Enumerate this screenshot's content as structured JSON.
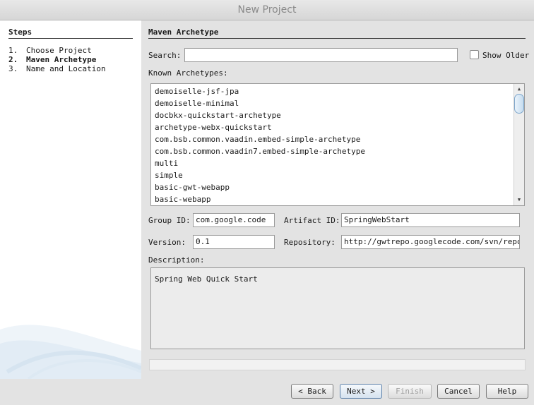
{
  "window": {
    "title": "New Project"
  },
  "steps": {
    "heading": "Steps",
    "items": [
      {
        "num": "1.",
        "label": "Choose Project"
      },
      {
        "num": "2.",
        "label": "Maven Archetype"
      },
      {
        "num": "3.",
        "label": "Name and Location"
      }
    ]
  },
  "panel": {
    "title": "Maven Archetype",
    "search_label": "Search:",
    "search_value": "",
    "show_older_label": "Show Older",
    "known_archetypes_label": "Known Archetypes:",
    "archetypes": [
      "demoiselle-jsf-jpa",
      "demoiselle-minimal",
      "docbkx-quickstart-archetype",
      "archetype-webx-quickstart",
      "com.bsb.common.vaadin.embed-simple-archetype",
      "com.bsb.common.vaadin7.embed-simple-archetype",
      "multi",
      "simple",
      "basic-gwt-webapp",
      "basic-webapp"
    ],
    "group_id_label": "Group ID:",
    "group_id_value": "com.google.code",
    "artifact_id_label": "Artifact ID:",
    "artifact_id_value": "SpringWebStart",
    "version_label": "Version:",
    "version_value": "0.1",
    "repository_label": "Repository:",
    "repository_value": "http://gwtrepo.googlecode.com/svn/repo",
    "description_label": "Description:",
    "description_value": "Spring Web Quick Start"
  },
  "buttons": {
    "back": "< Back",
    "next": "Next >",
    "finish": "Finish",
    "cancel": "Cancel",
    "help": "Help"
  }
}
